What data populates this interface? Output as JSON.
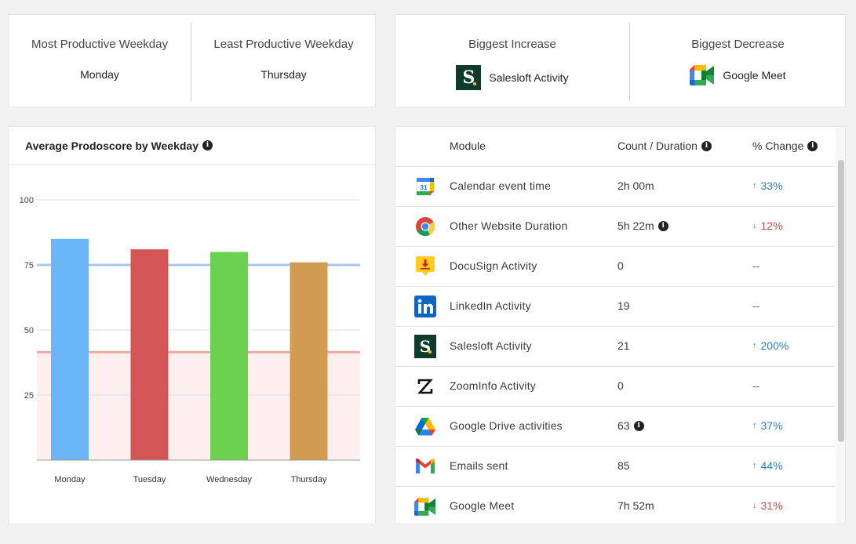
{
  "weekday_stats": {
    "most_label": "Most Productive Weekday",
    "most_value": "Monday",
    "least_label": "Least Productive Weekday",
    "least_value": "Thursday"
  },
  "change_stats": {
    "increase_label": "Biggest Increase",
    "increase_app": "Salesloft Activity",
    "decrease_label": "Biggest Decrease",
    "decrease_app": "Google Meet"
  },
  "chart_title": "Average Prodoscore by Weekday",
  "chart_data": {
    "type": "bar",
    "title": "Average Prodoscore by Weekday",
    "categories": [
      "Monday",
      "Tuesday",
      "Wednesday",
      "Thursday"
    ],
    "values": [
      85,
      81,
      80,
      76
    ],
    "colors": [
      "#6bb6f8",
      "#d45555",
      "#6cd150",
      "#d19c52"
    ],
    "ylim": [
      0,
      100
    ],
    "yticks": [
      25,
      50,
      75,
      100
    ],
    "reference_lines": [
      {
        "value": 75,
        "color": "#a9c8ea"
      },
      {
        "value": 41.5,
        "color": "#f0a7a4"
      }
    ],
    "low_band": {
      "from": 0,
      "to": 41.5,
      "color": "#fdf0ef"
    },
    "grid": true
  },
  "table": {
    "headers": {
      "module": "Module",
      "count": "Count / Duration",
      "change": "% Change"
    },
    "rows": [
      {
        "icon": "calendar-icon",
        "name": "Calendar event time",
        "count": "2h 00m",
        "info": false,
        "change": "33%",
        "dir": "up"
      },
      {
        "icon": "chrome-icon",
        "name": "Other Website Duration",
        "count": "5h 22m",
        "info": true,
        "change": "12%",
        "dir": "down"
      },
      {
        "icon": "docusign-icon",
        "name": "DocuSign Activity",
        "count": "0",
        "info": false,
        "change": "--",
        "dir": "none"
      },
      {
        "icon": "linkedin-icon",
        "name": "LinkedIn Activity",
        "count": "19",
        "info": false,
        "change": "--",
        "dir": "none"
      },
      {
        "icon": "salesloft-icon",
        "name": "Salesloft Activity",
        "count": "21",
        "info": false,
        "change": "200%",
        "dir": "up"
      },
      {
        "icon": "zoominfo-icon",
        "name": "ZoomInfo Activity",
        "count": "0",
        "info": false,
        "change": "--",
        "dir": "none"
      },
      {
        "icon": "google-drive-icon",
        "name": "Google Drive activities",
        "count": "63",
        "info": true,
        "change": "37%",
        "dir": "up"
      },
      {
        "icon": "gmail-icon",
        "name": "Emails sent",
        "count": "85",
        "info": false,
        "change": "44%",
        "dir": "up"
      },
      {
        "icon": "google-meet-icon",
        "name": "Google Meet",
        "count": "7h 52m",
        "info": false,
        "change": "31%",
        "dir": "down"
      }
    ]
  },
  "colors": {
    "up": "#2d7fc7",
    "down": "#e0443c"
  }
}
